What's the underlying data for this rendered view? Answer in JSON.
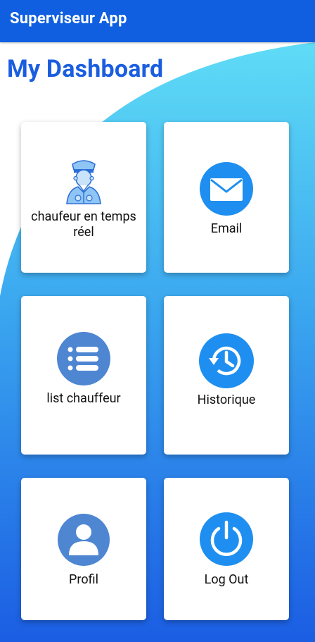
{
  "app": {
    "title": "Superviseur App"
  },
  "dashboard": {
    "title": "My Dashboard",
    "cards": [
      {
        "id": "realtime-driver",
        "label": "chaufeur en temps réel",
        "icon": "driver-icon"
      },
      {
        "id": "email",
        "label": "Email",
        "icon": "envelope-icon"
      },
      {
        "id": "driver-list",
        "label": "list chauffeur",
        "icon": "list-icon"
      },
      {
        "id": "history",
        "label": "Historique",
        "icon": "history-icon"
      },
      {
        "id": "profile",
        "label": "Profil",
        "icon": "user-icon"
      },
      {
        "id": "logout",
        "label": "Log Out",
        "icon": "power-icon"
      }
    ]
  },
  "colors": {
    "appbar": "#0f5fe0",
    "accent": "#1e8ff0",
    "gradient_top": "#5fd8f5",
    "gradient_bottom": "#1b5fe3"
  }
}
